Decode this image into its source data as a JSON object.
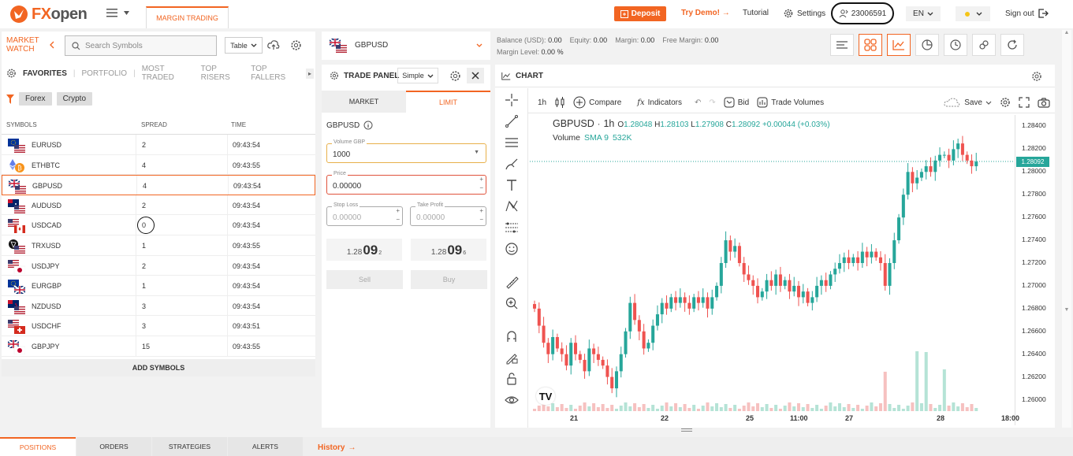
{
  "app": {
    "logo_text_fx": "FX",
    "logo_text_open": "open",
    "tab_label": "MARGIN TRADING"
  },
  "header": {
    "deposit": "Deposit",
    "try_demo": "Try Demo!",
    "tutorial": "Tutorial",
    "settings": "Settings",
    "account_number": "23006591",
    "language": "EN",
    "sign_out": "Sign out"
  },
  "market_watch": {
    "title_line1": "MARKET",
    "title_line2": "WATCH",
    "search_placeholder": "Search Symbols",
    "view_select": "Table",
    "tabs": [
      "FAVORITES",
      "PORTFOLIO",
      "MOST TRADED",
      "TOP RISERS",
      "TOP FALLERS"
    ],
    "filters": [
      "Forex",
      "Crypto"
    ],
    "columns": [
      "SYMBOLS",
      "SPREAD",
      "TIME"
    ],
    "rows": [
      {
        "symbol": "EURUSD",
        "spread": "2",
        "time": "09:43:54",
        "flag": "eu-us"
      },
      {
        "symbol": "ETHBTC",
        "spread": "4",
        "time": "09:43:55",
        "flag": "eth-btc"
      },
      {
        "symbol": "GBPUSD",
        "spread": "4",
        "time": "09:43:54",
        "flag": "gb-us"
      },
      {
        "symbol": "AUDUSD",
        "spread": "2",
        "time": "09:43:54",
        "flag": "au-us"
      },
      {
        "symbol": "USDCAD",
        "spread": "0",
        "time": "09:43:54",
        "flag": "us-ca"
      },
      {
        "symbol": "TRXUSD",
        "spread": "1",
        "time": "09:43:55",
        "flag": "trx-us"
      },
      {
        "symbol": "USDJPY",
        "spread": "2",
        "time": "09:43:54",
        "flag": "us-jp"
      },
      {
        "symbol": "EURGBP",
        "spread": "1",
        "time": "09:43:54",
        "flag": "eu-gb"
      },
      {
        "symbol": "NZDUSD",
        "spread": "3",
        "time": "09:43:54",
        "flag": "nz-us"
      },
      {
        "symbol": "USDCHF",
        "spread": "3",
        "time": "09:43:51",
        "flag": "us-ch"
      },
      {
        "symbol": "GBPJPY",
        "spread": "15",
        "time": "09:43:55",
        "flag": "gb-jp"
      }
    ],
    "add_symbols": "ADD SYMBOLS"
  },
  "symbol_selector": {
    "symbol": "GBPUSD"
  },
  "account": {
    "balance_label": "Balance",
    "balance_currency": "(USD):",
    "balance": "0.00",
    "equity_label": "Equity:",
    "equity": "0.00",
    "margin_label": "Margin:",
    "margin": "0.00",
    "free_margin_label": "Free Margin:",
    "free_margin": "0.00",
    "margin_level_label": "Margin Level:",
    "margin_level": "0.00 %"
  },
  "trade_panel": {
    "title": "TRADE PANEL",
    "mode": "Simple",
    "tabs": [
      "MARKET",
      "LIMIT"
    ],
    "symbol": "GBPUSD",
    "volume_label": "Volume GBP",
    "volume": "1000",
    "price_label": "Price",
    "price": "0.00000",
    "stop_loss_label": "Stop Loss",
    "stop_loss": "0.00000",
    "take_profit_label": "Take Profit",
    "take_profit": "0.00000",
    "sell_quote": {
      "prefix": "1.28",
      "big": "09",
      "pip": "2"
    },
    "buy_quote": {
      "prefix": "1.28",
      "big": "09",
      "pip": "6"
    },
    "sell": "Sell",
    "buy": "Buy"
  },
  "chart": {
    "panel_title": "CHART",
    "toolbar": {
      "interval": "1h",
      "compare": "Compare",
      "indicators": "Indicators",
      "bid": "Bid",
      "trade_volumes": "Trade Volumes",
      "save": "Save"
    },
    "legend": {
      "symbol": "GBPUSD",
      "interval": "1h",
      "o_label": "O",
      "o": "1.28048",
      "h_label": "H",
      "h": "1.28103",
      "l_label": "L",
      "l": "1.27908",
      "c_label": "C",
      "c": "1.28092",
      "change": "+0.00044 (+0.03%)"
    },
    "volume_legend": {
      "label": "Volume",
      "sma": "SMA 9",
      "value": "532K"
    },
    "last_price": "1.28092",
    "colors": {
      "up": "#26a69a",
      "down": "#ef5350"
    }
  },
  "chart_data": {
    "type": "candlestick",
    "y_ticks": [
      "1.28400",
      "1.28200",
      "1.28000",
      "1.27800",
      "1.27600",
      "1.27400",
      "1.27200",
      "1.27000",
      "1.26800",
      "1.26600",
      "1.26400",
      "1.26200",
      "1.26000"
    ],
    "ylim": [
      1.259,
      1.285
    ],
    "x_ticks": [
      "21",
      "22",
      "25",
      "11:00",
      "27",
      "28",
      "18:00"
    ],
    "close_series": [
      1.268,
      1.2665,
      1.265,
      1.264,
      1.2655,
      1.2645,
      1.264,
      1.263,
      1.265,
      1.264,
      1.2635,
      1.2625,
      1.2645,
      1.264,
      1.2635,
      1.263,
      1.262,
      1.261,
      1.2625,
      1.264,
      1.266,
      1.2685,
      1.267,
      1.266,
      1.2645,
      1.265,
      1.2665,
      1.2675,
      1.2685,
      1.268,
      1.269,
      1.2685,
      1.269,
      1.2685,
      1.268,
      1.269,
      1.2685,
      1.269,
      1.268,
      1.269,
      1.27,
      1.272,
      1.274,
      1.273,
      1.2735,
      1.272,
      1.271,
      1.2705,
      1.27,
      1.269,
      1.2695,
      1.2705,
      1.27,
      1.271,
      1.27,
      1.2705,
      1.2695,
      1.27,
      1.269,
      1.2695,
      1.2685,
      1.269,
      1.27,
      1.2705,
      1.27,
      1.271,
      1.2715,
      1.272,
      1.2725,
      1.272,
      1.2725,
      1.272,
      1.273,
      1.2725,
      1.273,
      1.2725,
      1.272,
      1.27,
      1.272,
      1.274,
      1.276,
      1.278,
      1.28,
      1.279,
      1.2795,
      1.28,
      1.2805,
      1.28,
      1.281,
      1.2815,
      1.2815,
      1.281,
      1.282,
      1.2825,
      1.2815,
      1.281,
      1.2805,
      1.2809
    ]
  },
  "bottom_tabs": [
    "POSITIONS",
    "ORDERS",
    "STRATEGIES",
    "ALERTS"
  ],
  "history": "History"
}
